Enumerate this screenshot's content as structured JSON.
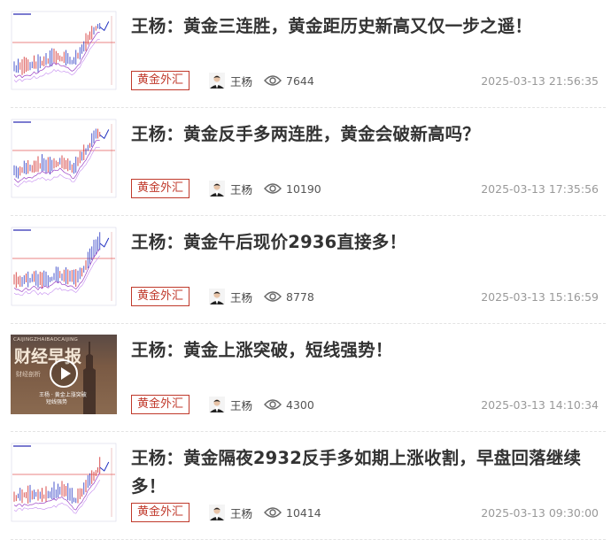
{
  "articles": [
    {
      "title": "王杨：黄金三连胜，黄金距历史新高又仅一步之遥！",
      "tag": "黄金外汇",
      "author": "王杨",
      "views": "7644",
      "time": "2025-03-13 21:56:35",
      "thumb": "chart"
    },
    {
      "title": "王杨：黄金反手多两连胜，黄金会破新高吗？",
      "tag": "黄金外汇",
      "author": "王杨",
      "views": "10190",
      "time": "2025-03-13 17:35:56",
      "thumb": "chart"
    },
    {
      "title": "王杨：黄金午后现价2936直接多！",
      "tag": "黄金外汇",
      "author": "王杨",
      "views": "8778",
      "time": "2025-03-13 15:16:59",
      "thumb": "chart"
    },
    {
      "title": "王杨：黄金上涨突破，短线强势！",
      "tag": "黄金外汇",
      "author": "王杨",
      "views": "4300",
      "time": "2025-03-13 14:10:34",
      "thumb": "video",
      "thumb_text": {
        "top": "CAIJINGZHAIBAOCAIJING",
        "main": "财经早报",
        "sub": "财经剖析",
        "cap1": "王杨 · 黄金上涨突破",
        "cap2": "短线强势"
      }
    },
    {
      "title": "王杨：黄金隔夜2932反手多如期上涨收割，早盘回落继续多！",
      "tag": "黄金外汇",
      "author": "王杨",
      "views": "10414",
      "time": "2025-03-13 09:30:00",
      "thumb": "chart"
    }
  ],
  "colors": {
    "tag": "#c0392b",
    "title": "#333333",
    "meta": "#999999"
  }
}
